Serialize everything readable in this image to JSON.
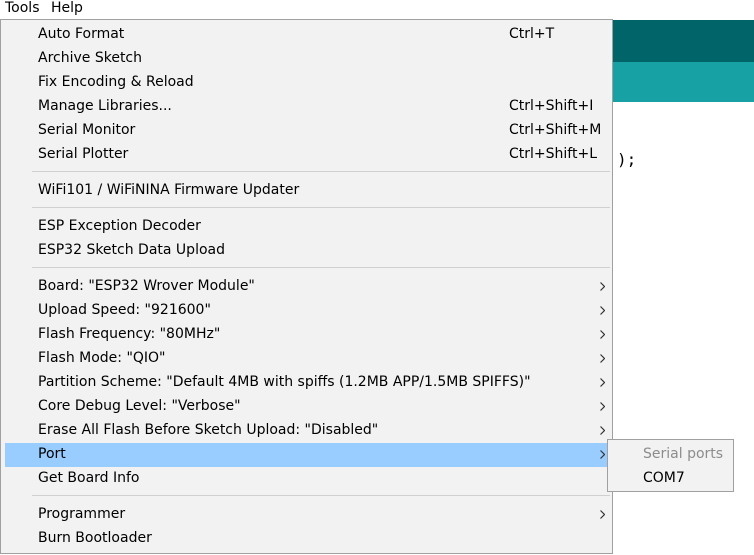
{
  "menubar": {
    "tools": "Tools",
    "help": "Help"
  },
  "editor": {
    "code_fragment": ");"
  },
  "menu": {
    "items": [
      {
        "label": "Auto Format",
        "shortcut": "Ctrl+T"
      },
      {
        "label": "Archive Sketch",
        "shortcut": ""
      },
      {
        "label": "Fix Encoding & Reload",
        "shortcut": ""
      },
      {
        "label": "Manage Libraries...",
        "shortcut": "Ctrl+Shift+I"
      },
      {
        "label": "Serial Monitor",
        "shortcut": "Ctrl+Shift+M"
      },
      {
        "label": "Serial Plotter",
        "shortcut": "Ctrl+Shift+L"
      },
      {
        "label": "WiFi101 / WiFiNINA Firmware Updater",
        "shortcut": ""
      },
      {
        "label": "ESP Exception Decoder",
        "shortcut": ""
      },
      {
        "label": "ESP32 Sketch Data Upload",
        "shortcut": ""
      },
      {
        "label": "Board: \"ESP32 Wrover Module\"",
        "shortcut": ""
      },
      {
        "label": "Upload Speed: \"921600\"",
        "shortcut": ""
      },
      {
        "label": "Flash Frequency: \"80MHz\"",
        "shortcut": ""
      },
      {
        "label": "Flash Mode: \"QIO\"",
        "shortcut": ""
      },
      {
        "label": "Partition Scheme: \"Default 4MB with spiffs (1.2MB APP/1.5MB SPIFFS)\"",
        "shortcut": ""
      },
      {
        "label": "Core Debug Level: \"Verbose\"",
        "shortcut": ""
      },
      {
        "label": "Erase All Flash Before Sketch Upload: \"Disabled\"",
        "shortcut": ""
      },
      {
        "label": "Port",
        "shortcut": ""
      },
      {
        "label": "Get Board Info",
        "shortcut": ""
      },
      {
        "label": "Programmer",
        "shortcut": ""
      },
      {
        "label": "Burn Bootloader",
        "shortcut": ""
      }
    ]
  },
  "submenu": {
    "header": "Serial ports",
    "ports": [
      "COM7"
    ]
  },
  "colors": {
    "menu_bg": "#f2f2f2",
    "highlight": "#99ccff",
    "editor_header": "#006468",
    "editor_tabs": "#17a1a5"
  }
}
